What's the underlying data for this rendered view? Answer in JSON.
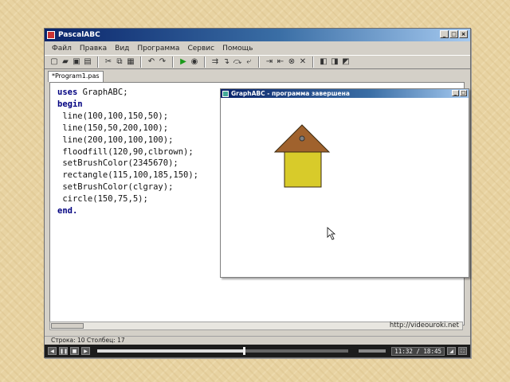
{
  "ide": {
    "title": "PascalABC",
    "menu": [
      "Файл",
      "Правка",
      "Вид",
      "Программа",
      "Сервис",
      "Помощь"
    ],
    "tab_label": "*Program1.pas",
    "code_lines": [
      {
        "kw": "uses",
        "rest": " GraphABC;"
      },
      {
        "kw": "begin",
        "rest": ""
      },
      {
        "kw": "",
        "rest": " line(100,100,150,50);"
      },
      {
        "kw": "",
        "rest": " line(150,50,200,100);"
      },
      {
        "kw": "",
        "rest": " line(200,100,100,100);"
      },
      {
        "kw": "",
        "rest": " floodfill(120,90,clbrown);"
      },
      {
        "kw": "",
        "rest": " setBrushColor(2345670);"
      },
      {
        "kw": "",
        "rest": " rectangle(115,100,185,150);"
      },
      {
        "kw": "",
        "rest": " setBrushColor(clgray);"
      },
      {
        "kw": "",
        "rest": " circle(150,75,5);"
      },
      {
        "kw": "end.",
        "rest": ""
      }
    ],
    "watermark_url": "http://videouroki.net",
    "status_text": "Строка: 10   Столбец: 17"
  },
  "graph_window": {
    "title": "GraphABC - программа завершена"
  },
  "player": {
    "time": "11:32 / 18:45",
    "progress": 0.58,
    "volume": 0.8
  },
  "colors": {
    "roof": "#a0622d",
    "wall": "#d8cb2a",
    "chimney_dot": "#808080"
  },
  "icons": [
    "new-file-icon",
    "open-icon",
    "save-icon",
    "save-all-icon",
    "cut-icon",
    "copy-icon",
    "paste-icon",
    "undo-icon",
    "redo-icon",
    "run-icon",
    "stop-icon"
  ]
}
